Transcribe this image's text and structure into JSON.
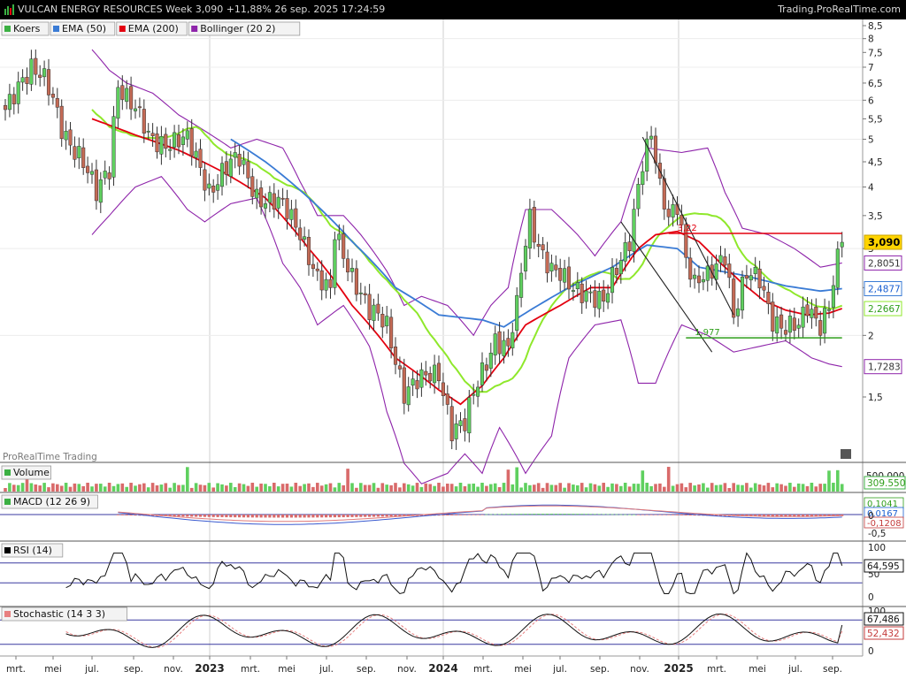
{
  "header": {
    "title": "VULCAN ENERGY RESOURCES Week 3,090 +11,88% 26 sep. 2025 17:24:59",
    "brand": "Trading.ProRealTime.com"
  },
  "watermark": "ProRealTime Trading",
  "legend": [
    {
      "label": "Koers",
      "color": "#3cb043"
    },
    {
      "label": "EMA (50)",
      "color": "#3a7bd5"
    },
    {
      "label": "EMA (200)",
      "color": "#e3000f"
    },
    {
      "label": "Bollinger (20 2)",
      "color": "#8e24aa"
    }
  ],
  "price_axis": {
    "ticks": [
      "8,5",
      "8",
      "7,5",
      "7",
      "6,5",
      "6",
      "5,5",
      "5",
      "4,5",
      "4",
      "3,5",
      "3",
      "2,5",
      "2",
      "1,5"
    ],
    "badges": [
      {
        "text": "3,090",
        "value": 3.09,
        "bg": "#ffd400",
        "fg": "#000000",
        "border": "#c9a400",
        "bold": true
      },
      {
        "text": "2,8051",
        "value": 2.8051,
        "bg": "#ffffff",
        "fg": "#333333",
        "border": "#8e24aa"
      },
      {
        "text": "2,4877",
        "value": 2.4877,
        "bg": "#ffffff",
        "fg": "#1a5fd1",
        "border": "#3a7bd5"
      },
      {
        "text": "2,2667",
        "value": 2.2667,
        "bg": "#ffffff",
        "fg": "#2e9e1a",
        "border": "#8fe82b"
      },
      {
        "text": "1,7283",
        "value": 1.7283,
        "bg": "#ffffff",
        "fg": "#333333",
        "border": "#8e24aa"
      }
    ]
  },
  "annotations": [
    {
      "text": "3,22",
      "value": 3.22,
      "color": "#e3000f"
    },
    {
      "text": "1,977",
      "value": 1.977,
      "color": "#2e9e1a"
    }
  ],
  "time_axis": [
    "mrt.",
    "mei",
    "jul.",
    "sep.",
    "nov.",
    "2023",
    "mrt.",
    "mei",
    "jul.",
    "sep.",
    "nov.",
    "2024",
    "mrt.",
    "mei",
    "jul.",
    "sep.",
    "nov.",
    "2025",
    "mrt.",
    "mei",
    "jul.",
    "sep."
  ],
  "panels": {
    "volume": {
      "label": "Volume",
      "color": "#3cb043",
      "value_text": "309.550",
      "axis_text": "500.000"
    },
    "macd": {
      "label": "MACD (12 26 9)",
      "color": "#3cb043",
      "values": [
        "0,1041",
        "0,0167",
        "-0,1208"
      ],
      "axis": [
        "0",
        "-0,5"
      ]
    },
    "rsi": {
      "label": "RSI (14)",
      "color": "#000000",
      "value_text": "64,595",
      "axis": [
        "100",
        "50",
        "0"
      ]
    },
    "stochastic": {
      "label": "Stochastic (14 3 3)",
      "color": "#e88080",
      "values": [
        "67,486",
        "52,432"
      ],
      "axis": [
        "100",
        "50",
        "0"
      ]
    }
  },
  "chart_data": {
    "type": "candlestick",
    "interval": "week",
    "x_range": [
      "2022-02",
      "2025-09"
    ],
    "ylim": [
      1.0,
      8.5
    ],
    "y_scale": "log",
    "grid": true,
    "current_price": 3.09,
    "change_pct": 11.88,
    "waypoints": [
      [
        0,
        5.6
      ],
      [
        4,
        6.8
      ],
      [
        6,
        7.1
      ],
      [
        9,
        6.5
      ],
      [
        13,
        5.3
      ],
      [
        17,
        4.7
      ],
      [
        21,
        3.8
      ],
      [
        24,
        4.4
      ],
      [
        26,
        6.6
      ],
      [
        29,
        5.9
      ],
      [
        33,
        5.0
      ],
      [
        38,
        5.0
      ],
      [
        42,
        4.9
      ],
      [
        47,
        4.0
      ],
      [
        50,
        4.3
      ],
      [
        54,
        4.5
      ],
      [
        58,
        3.9
      ],
      [
        64,
        3.6
      ],
      [
        68,
        3.3
      ],
      [
        72,
        2.6
      ],
      [
        75,
        2.4
      ],
      [
        76,
        3.2
      ],
      [
        80,
        2.7
      ],
      [
        84,
        2.2
      ],
      [
        88,
        2.1
      ],
      [
        92,
        1.55
      ],
      [
        96,
        1.6
      ],
      [
        100,
        1.7
      ],
      [
        103,
        1.3
      ],
      [
        106,
        1.3
      ],
      [
        110,
        1.7
      ],
      [
        113,
        2.0
      ],
      [
        116,
        1.85
      ],
      [
        118,
        2.25
      ],
      [
        121,
        3.5
      ],
      [
        123,
        3.1
      ],
      [
        126,
        2.7
      ],
      [
        130,
        2.5
      ],
      [
        134,
        2.5
      ],
      [
        138,
        2.3
      ],
      [
        141,
        2.7
      ],
      [
        144,
        3.2
      ],
      [
        147,
        4.5
      ],
      [
        149,
        5.0
      ],
      [
        151,
        3.9
      ],
      [
        153,
        3.5
      ],
      [
        155,
        3.8
      ],
      [
        157,
        2.9
      ],
      [
        159,
        2.5
      ],
      [
        162,
        2.6
      ],
      [
        166,
        3.0
      ],
      [
        168,
        2.2
      ],
      [
        171,
        2.6
      ],
      [
        174,
        2.6
      ],
      [
        177,
        2.2
      ],
      [
        180,
        2.05
      ],
      [
        183,
        2.05
      ],
      [
        185,
        2.3
      ],
      [
        188,
        2.15
      ],
      [
        190,
        2.3
      ],
      [
        192,
        2.8
      ],
      [
        193,
        3.09
      ]
    ],
    "ema50_waypoints": [
      [
        52,
        5.0
      ],
      [
        60,
        4.5
      ],
      [
        70,
        3.8
      ],
      [
        80,
        3.1
      ],
      [
        90,
        2.5
      ],
      [
        100,
        2.2
      ],
      [
        110,
        2.15
      ],
      [
        115,
        2.08
      ],
      [
        120,
        2.22
      ],
      [
        130,
        2.5
      ],
      [
        140,
        2.75
      ],
      [
        148,
        3.05
      ],
      [
        155,
        3.0
      ],
      [
        160,
        2.75
      ],
      [
        170,
        2.65
      ],
      [
        180,
        2.52
      ],
      [
        188,
        2.46
      ],
      [
        193,
        2.4877
      ]
    ],
    "ema200_waypoints": [
      [
        20,
        5.5
      ],
      [
        30,
        5.1
      ],
      [
        40,
        4.75
      ],
      [
        50,
        4.3
      ],
      [
        60,
        3.8
      ],
      [
        70,
        3.0
      ],
      [
        80,
        2.3
      ],
      [
        90,
        1.8
      ],
      [
        100,
        1.55
      ],
      [
        105,
        1.45
      ],
      [
        110,
        1.58
      ],
      [
        115,
        1.8
      ],
      [
        120,
        2.1
      ],
      [
        128,
        2.3
      ],
      [
        135,
        2.5
      ],
      [
        140,
        2.5
      ],
      [
        146,
        3.0
      ],
      [
        150,
        3.2
      ],
      [
        155,
        3.25
      ],
      [
        160,
        3.1
      ],
      [
        165,
        2.8
      ],
      [
        170,
        2.55
      ],
      [
        175,
        2.35
      ],
      [
        180,
        2.25
      ],
      [
        185,
        2.2
      ],
      [
        190,
        2.22
      ],
      [
        193,
        2.2667
      ]
    ],
    "bb_upper_waypoints": [
      [
        20,
        7.6
      ],
      [
        24,
        6.9
      ],
      [
        28,
        6.5
      ],
      [
        34,
        6.2
      ],
      [
        40,
        5.6
      ],
      [
        46,
        5.2
      ],
      [
        52,
        4.8
      ],
      [
        58,
        5.0
      ],
      [
        64,
        4.8
      ],
      [
        68,
        4.1
      ],
      [
        72,
        3.5
      ],
      [
        78,
        3.5
      ],
      [
        82,
        3.2
      ],
      [
        88,
        2.7
      ],
      [
        92,
        2.3
      ],
      [
        96,
        2.4
      ],
      [
        102,
        2.3
      ],
      [
        108,
        2.0
      ],
      [
        112,
        2.3
      ],
      [
        116,
        2.5
      ],
      [
        120,
        3.6
      ],
      [
        126,
        3.6
      ],
      [
        132,
        3.2
      ],
      [
        136,
        2.9
      ],
      [
        142,
        3.4
      ],
      [
        148,
        4.8
      ],
      [
        156,
        4.7
      ],
      [
        162,
        4.8
      ],
      [
        166,
        3.9
      ],
      [
        170,
        3.3
      ],
      [
        176,
        3.2
      ],
      [
        182,
        3.0
      ],
      [
        188,
        2.75
      ],
      [
        193,
        2.8051
      ]
    ],
    "bb_lower_waypoints": [
      [
        20,
        3.2
      ],
      [
        24,
        3.5
      ],
      [
        30,
        4.0
      ],
      [
        36,
        4.2
      ],
      [
        42,
        3.6
      ],
      [
        46,
        3.4
      ],
      [
        52,
        3.7
      ],
      [
        58,
        3.8
      ],
      [
        64,
        2.8
      ],
      [
        68,
        2.5
      ],
      [
        72,
        2.1
      ],
      [
        78,
        2.3
      ],
      [
        84,
        1.9
      ],
      [
        88,
        1.4
      ],
      [
        92,
        1.1
      ],
      [
        96,
        1.0
      ],
      [
        102,
        1.05
      ],
      [
        106,
        1.15
      ],
      [
        110,
        1.05
      ],
      [
        114,
        1.3
      ],
      [
        120,
        1.05
      ],
      [
        126,
        1.25
      ],
      [
        130,
        1.8
      ],
      [
        136,
        2.1
      ],
      [
        142,
        2.15
      ],
      [
        146,
        1.6
      ],
      [
        150,
        1.6
      ],
      [
        156,
        2.1
      ],
      [
        162,
        2.0
      ],
      [
        168,
        1.85
      ],
      [
        174,
        1.9
      ],
      [
        180,
        1.95
      ],
      [
        186,
        1.8
      ],
      [
        190,
        1.75
      ],
      [
        193,
        1.7283
      ]
    ],
    "trendlines": [
      {
        "kind": "channel",
        "from": [
          147,
          5.05
        ],
        "to": [
          168,
          2.2
        ]
      },
      {
        "kind": "channel",
        "from": [
          142,
          3.4
        ],
        "to": [
          163,
          1.85
        ]
      },
      {
        "kind": "resistance",
        "from": [
          153,
          3.22
        ],
        "to": [
          193,
          3.22
        ]
      },
      {
        "kind": "support",
        "from": [
          157,
          1.977
        ],
        "to": [
          193,
          1.977
        ]
      }
    ]
  }
}
